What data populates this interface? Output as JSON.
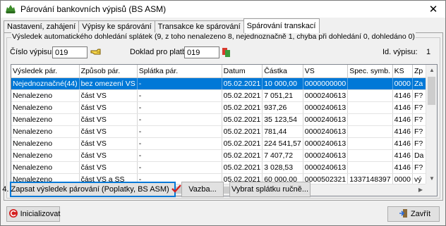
{
  "window": {
    "title": "Párování bankovních výpisů (BS ASM)"
  },
  "tabs": [
    {
      "label": "Nastavení, zahájení"
    },
    {
      "label": "Výpisy ke spárování"
    },
    {
      "label": "Transakce ke spárování"
    },
    {
      "label": "Spárování transkací"
    }
  ],
  "group": {
    "caption": "Výsledek automatického dohledání splátek (9, z toho nenalezeno 8, nejednoznačně 1, chyba při dohledání 0, dohledáno 0)"
  },
  "fields": {
    "cislo_vypisu_label": "Číslo výpisu",
    "cislo_vypisu_value": "019",
    "doklad_label": "Doklad pro platbu",
    "doklad_value": "019",
    "id_vypisu_label": "Id. výpisu:",
    "id_vypisu_value": "1"
  },
  "table": {
    "columns": [
      "Výsledek pár.",
      "Způsob pár.",
      "Splátka pár.",
      "Datum",
      "Částka",
      "VS",
      "Spec. symb.",
      "KS",
      "Zp"
    ],
    "rows": [
      [
        "Nejednoznačné(44)",
        "bez omezení VS",
        "-",
        "05.02.2021",
        "10 000,00",
        "0000000000",
        "",
        "0000",
        "Za"
      ],
      [
        "Nenalezeno",
        "část VS",
        "-",
        "05.02.2021",
        "7 051,21",
        "0000240613",
        "",
        "4146",
        "F?"
      ],
      [
        "Nenalezeno",
        "část VS",
        "-",
        "05.02.2021",
        "937,26",
        "0000240613",
        "",
        "4146",
        "F?"
      ],
      [
        "Nenalezeno",
        "část VS",
        "-",
        "05.02.2021",
        "35 123,54",
        "0000240613",
        "",
        "4146",
        "F?"
      ],
      [
        "Nenalezeno",
        "část VS",
        "-",
        "05.02.2021",
        "781,44",
        "0000240613",
        "",
        "4146",
        "F?"
      ],
      [
        "Nenalezeno",
        "část VS",
        "-",
        "05.02.2021",
        "224 541,57",
        "0000240613",
        "",
        "4146",
        "F?"
      ],
      [
        "Nenalezeno",
        "část VS",
        "-",
        "05.02.2021",
        "7 407,72",
        "0000240613",
        "",
        "4146",
        "Da"
      ],
      [
        "Nenalezeno",
        "část VS",
        "-",
        "05.02.2021",
        "3 028,53",
        "0000240613",
        "",
        "4146",
        "F?"
      ],
      [
        "Nenalezeno",
        "část VS a SS",
        "-",
        "05.02.2021",
        "60 000,00",
        "0000502321",
        "1337148397",
        "0000",
        "vý"
      ]
    ]
  },
  "buttons": {
    "zapsat": "4. Zapsat výsledek párování  (Poplatky, BS ASM)",
    "vazba": "Vazba...",
    "vybrat": "Vybrat splátku ručně...",
    "inicializovat": "Inicializovat",
    "zavrit": "Zavřít"
  }
}
